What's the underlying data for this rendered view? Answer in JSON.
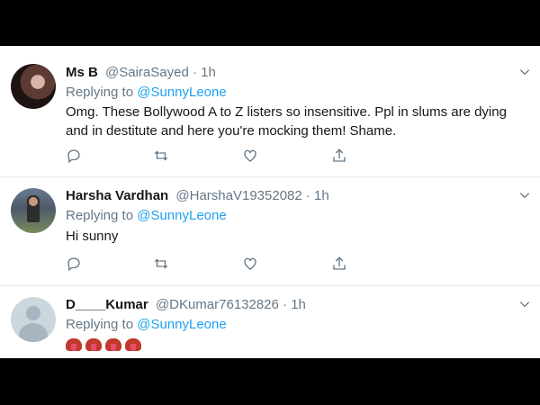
{
  "tweets": [
    {
      "name": "Ms B",
      "handle": "@SairaSayed",
      "time": "· 1h",
      "replying_prefix": "Replying to ",
      "replying_to": "@SunnyLeone",
      "text": "Omg. These Bollywood A to Z listers so insensitive. Ppl in slums are dying and in destitute and here you're mocking them! Shame."
    },
    {
      "name": "Harsha Vardhan",
      "handle": "@HarshaV19352082",
      "time": "· 1h",
      "replying_prefix": "Replying to ",
      "replying_to": "@SunnyLeone",
      "text": "Hi sunny"
    },
    {
      "name": "D____Kumar",
      "handle": "@DKumar76132826",
      "time": "· 1h",
      "replying_prefix": "Replying to ",
      "replying_to": "@SunnyLeone",
      "emoji": [
        "tongue-emoji",
        "tongue-emoji",
        "tongue-emoji",
        "tongue-emoji"
      ]
    }
  ],
  "icons": {
    "reply": "reply-icon",
    "retweet": "retweet-icon",
    "like": "heart-icon",
    "share": "share-icon",
    "menu": "chevron-down-icon"
  },
  "colors": {
    "link": "#1da1f2",
    "muted": "#657786",
    "text": "#14171a"
  }
}
